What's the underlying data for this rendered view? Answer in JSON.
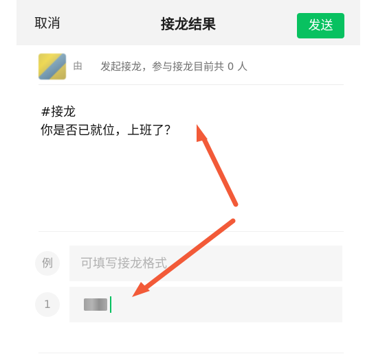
{
  "header": {
    "cancel_label": "取消",
    "title": "接龙结果",
    "send_label": "发送"
  },
  "meta": {
    "initiator_text": "由",
    "summary_text": "发起接龙，参与接龙目前共 0 人"
  },
  "content": {
    "text": "#接龙\n你是否已就位，上班了？"
  },
  "rows": {
    "example_index": "例",
    "example_placeholder": "可填写接龙格式",
    "entry_index": "1"
  },
  "colors": {
    "send_button": "#08c160",
    "arrow": "#f25a38"
  },
  "icons": {
    "avatar": "blurred-avatar",
    "arrow_up": "red-arrow-icon",
    "arrow_down": "red-arrow-icon"
  }
}
